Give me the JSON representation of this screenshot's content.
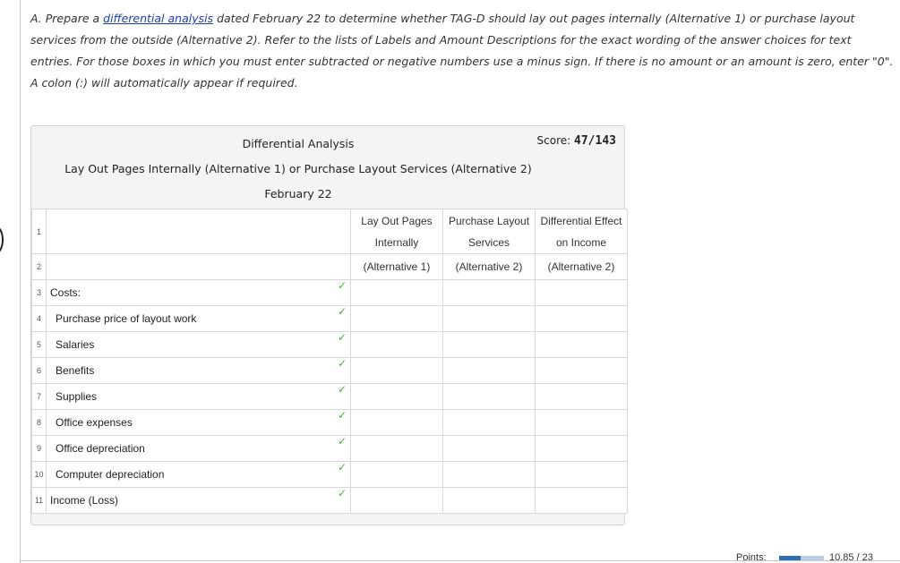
{
  "instructions": {
    "prefix": "A. Prepare a ",
    "link": "differential analysis",
    "suffix": " dated February 22 to determine whether TAG-D should lay out pages internally (Alternative 1) or purchase layout services from the outside (Alternative 2). Refer to the lists of Labels and Amount Descriptions for the exact wording of the answer choices for text entries. For those boxes in which you must enter subtracted or negative numbers use a minus sign. If there is no amount or an amount is zero, enter \"0\". A colon (:) will automatically appear if required."
  },
  "worksheet": {
    "title": "Differential Analysis",
    "subtitle": "Lay Out Pages Internally (Alternative 1) or Purchase Layout Services (Alternative 2)",
    "date": "February 22",
    "score_label": "Score:",
    "score_value": "47/143",
    "headers": {
      "col1_line1": "Lay Out Pages",
      "col1_line2": "Internally",
      "col1_line3": "(Alternative 1)",
      "col2_line1": "Purchase Layout",
      "col2_line2": "Services",
      "col2_line3": "(Alternative 2)",
      "col3_line1": "Differential Effect",
      "col3_line2": "on Income",
      "col3_line3": "(Alternative 2)"
    },
    "rows": [
      {
        "num": "3",
        "label": "Costs:",
        "check": "✓"
      },
      {
        "num": "4",
        "label": "Purchase price of layout work",
        "check": "✓"
      },
      {
        "num": "5",
        "label": "Salaries",
        "check": "✓"
      },
      {
        "num": "6",
        "label": "Benefits",
        "check": "✓"
      },
      {
        "num": "7",
        "label": "Supplies",
        "check": "✓"
      },
      {
        "num": "8",
        "label": "Office expenses",
        "check": "✓"
      },
      {
        "num": "9",
        "label": "Office depreciation",
        "check": "✓"
      },
      {
        "num": "10",
        "label": "Computer depreciation",
        "check": "✓"
      },
      {
        "num": "11",
        "label": "Income (Loss)",
        "check": "✓"
      }
    ]
  },
  "points": {
    "label": "Points:",
    "value": "10.85 / 23",
    "progress": 0.47
  }
}
